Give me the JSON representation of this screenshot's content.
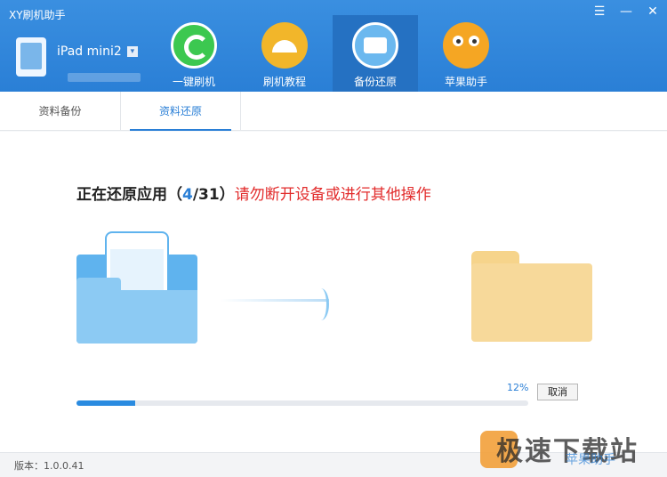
{
  "app": {
    "title": "XY刷机助手"
  },
  "window_controls": {
    "menu": "☰",
    "minimize": "—",
    "close": "✕"
  },
  "device": {
    "name": "iPad mini2",
    "dropdown": "▾"
  },
  "nav": [
    {
      "label": "一键刷机",
      "icon": "refresh-icon"
    },
    {
      "label": "刷机教程",
      "icon": "lamp-icon"
    },
    {
      "label": "备份还原",
      "icon": "backup-icon"
    },
    {
      "label": "苹果助手",
      "icon": "owl-icon"
    }
  ],
  "tabs": [
    {
      "label": "资料备份"
    },
    {
      "label": "资料还原"
    }
  ],
  "status": {
    "prefix": "正在还原应用（",
    "current": "4",
    "sep": "/31",
    "suffix": "）",
    "warning": "请勿断开设备或进行其他操作"
  },
  "progress": {
    "percent_label": "12%",
    "value": 0.13
  },
  "cancel": {
    "label": "取消"
  },
  "footer": {
    "version": "版本：1.0.0.41"
  },
  "watermark": {
    "text": "极速下载站",
    "sub": "苹果助手"
  }
}
